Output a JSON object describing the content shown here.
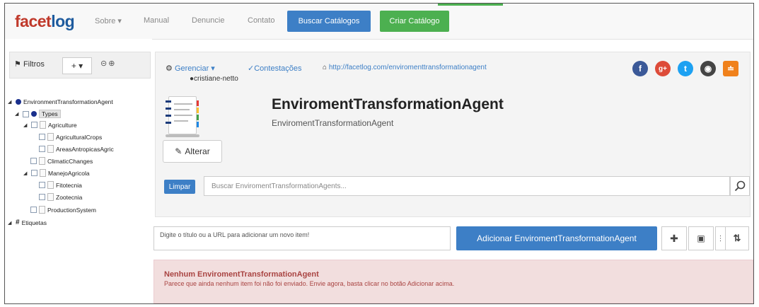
{
  "navbar": {
    "brand_part1": "facet",
    "brand_part2": "log",
    "items": [
      {
        "label": "Sobre ▾"
      },
      {
        "label": "Manual"
      },
      {
        "label": "Denuncie"
      },
      {
        "label": "Contato"
      }
    ],
    "buscar_catalogos": "Buscar Catálogos",
    "criar_catalogo": "Criar Catálogo"
  },
  "sidebar": {
    "filtros_label": "Filtros",
    "add_label": "+ ▾",
    "tree": {
      "root": "EnvironmentTransformationAgent",
      "types": "Types",
      "agriculture": "Agriculture",
      "agricultural_crops": "AgriculturalCrops",
      "areas_antropicas": "AreasAntropicasAgric",
      "climatic_changes": "ClimaticChanges",
      "manejo_agricola": "ManejoAgricola",
      "fitotecnia": "Fitotecnia",
      "zootecnia": "Zootecnia",
      "production_system": "ProductionSystem",
      "etiquetas": "Etiquetas"
    }
  },
  "header": {
    "gerenciar": "Gerenciar ▾",
    "contestacoes": "Contestações",
    "url": "http://facetlog.com/enviromenttransformationagent",
    "user": "cristiane-netto",
    "social_icons": [
      "facebook-icon",
      "google-plus-icon",
      "twitter-icon",
      "github-icon",
      "rss-icon"
    ],
    "title": "EnviromentTransformationAgent",
    "subtitle": "EnviromentTransformationAgent",
    "alterar": "Alterar",
    "limpar": "Limpar",
    "search_placeholder": "Buscar EnviromentTransformationAgents..."
  },
  "add_item": {
    "placeholder": "Digite o título ou a URL para adicionar um novo item!",
    "button": "Adicionar EnviromentTransformationAgent"
  },
  "alert": {
    "title": "Nenhum EnviromentTransformationAgent",
    "message": "Parece que ainda nenhum item foi não foi enviado. Envie agora, basta clicar no botão Adicionar acima."
  },
  "colors": {
    "brand_red": "#c0392b",
    "brand_blue": "#1e5b9e",
    "primary_blue": "#3d7fc6",
    "green": "#4cb050",
    "alert_bg": "#f2dede",
    "alert_text": "#a94442"
  }
}
